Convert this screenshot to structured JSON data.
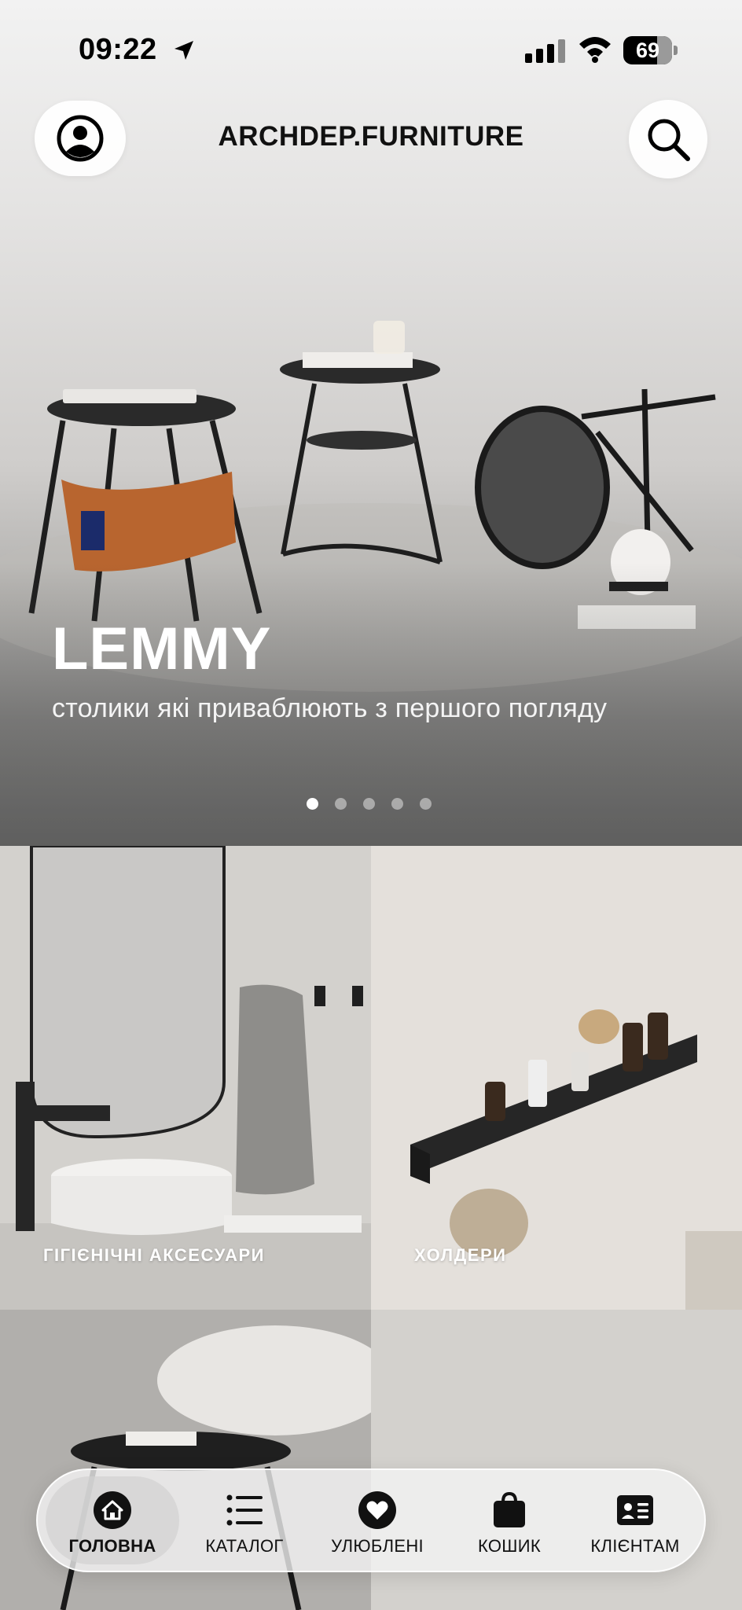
{
  "status_bar": {
    "time": "09:22",
    "battery": "69",
    "battery_level": 0.69
  },
  "header": {
    "brand": "ARCHDEP.FURNITURE",
    "profile_icon": "user-circle-icon",
    "search_icon": "search-icon"
  },
  "hero": {
    "title": "LEMMY",
    "subtitle": "столики які приваблюють з першого погляду",
    "slides_count": 5,
    "active_slide": 1
  },
  "categories": [
    {
      "label": "ГІГІЄНІЧНІ АКСЕСУАРИ"
    },
    {
      "label": "ХОЛДЕРИ"
    },
    {
      "label": ""
    },
    {
      "label": ""
    }
  ],
  "tab_bar": {
    "items": [
      {
        "label": "ГОЛОВНА",
        "icon": "home-icon",
        "active": true
      },
      {
        "label": "КАТАЛОГ",
        "icon": "list-icon",
        "active": false
      },
      {
        "label": "УЛЮБЛЕНІ",
        "icon": "heart-icon",
        "active": false
      },
      {
        "label": "КОШИК",
        "icon": "bag-icon",
        "active": false
      },
      {
        "label": "КЛІЄНТАМ",
        "icon": "contact-card-icon",
        "active": false
      }
    ]
  }
}
